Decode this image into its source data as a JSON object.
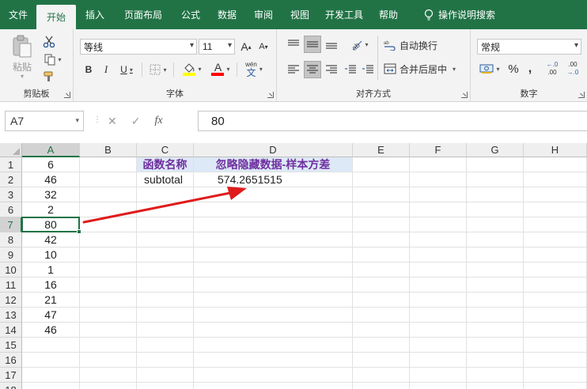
{
  "menu": {
    "tabs": [
      "文件",
      "开始",
      "插入",
      "页面布局",
      "公式",
      "数据",
      "审阅",
      "视图",
      "开发工具",
      "帮助"
    ],
    "active_index": 1,
    "tell_me": "操作说明搜索"
  },
  "ribbon": {
    "clipboard": {
      "paste_label": "粘贴",
      "group_label": "剪贴板"
    },
    "font": {
      "font_name": "等线",
      "font_size": "11",
      "grow": "A",
      "shrink": "A",
      "bold": "B",
      "italic": "I",
      "underline": "U",
      "font_color_letter": "A",
      "phonetic_small": "wén",
      "phonetic_big": "文",
      "group_label": "字体"
    },
    "alignment": {
      "wrap_text": "自动换行",
      "merge_center": "合并后居中",
      "group_label": "对齐方式"
    },
    "number": {
      "format": "常规",
      "percent": "%",
      "comma": ",",
      "inc_decimal": ".00",
      "dec_decimal": ".0",
      "group_label": "数字"
    },
    "colors": {
      "accent": "#217346",
      "fill_yellow": "#ffff00",
      "font_red": "#ff0000",
      "header_purple": "#7030a0",
      "header_fill": "#dde9f6"
    }
  },
  "formula_bar": {
    "name_box": "A7",
    "cancel": "✕",
    "enter": "✓",
    "fx": "fx",
    "value": "80"
  },
  "sheet": {
    "columns": [
      "A",
      "B",
      "C",
      "D",
      "E",
      "F",
      "G",
      "H"
    ],
    "selected_column": "A",
    "rows": [
      {
        "num": "1",
        "A": "6",
        "C": "函数名称",
        "D": "忽略隐藏数据-样本方差"
      },
      {
        "num": "2",
        "A": "46",
        "C": "subtotal",
        "D": "574.2651515"
      },
      {
        "num": "3",
        "A": "32",
        "C": "",
        "D": ""
      },
      {
        "num": "6",
        "A": "2",
        "C": "",
        "D": ""
      },
      {
        "num": "7",
        "A": "80",
        "C": "",
        "D": ""
      },
      {
        "num": "8",
        "A": "42",
        "C": "",
        "D": ""
      },
      {
        "num": "9",
        "A": "10",
        "C": "",
        "D": ""
      },
      {
        "num": "10",
        "A": "1",
        "C": "",
        "D": ""
      },
      {
        "num": "11",
        "A": "16",
        "C": "",
        "D": ""
      },
      {
        "num": "12",
        "A": "21",
        "C": "",
        "D": ""
      },
      {
        "num": "13",
        "A": "47",
        "C": "",
        "D": ""
      },
      {
        "num": "14",
        "A": "46",
        "C": "",
        "D": ""
      },
      {
        "num": "15",
        "A": "",
        "C": "",
        "D": ""
      },
      {
        "num": "16",
        "A": "",
        "C": "",
        "D": ""
      },
      {
        "num": "17",
        "A": "",
        "C": "",
        "D": ""
      },
      {
        "num": "18",
        "A": "",
        "C": "",
        "D": ""
      }
    ],
    "selected_row_index": 4,
    "arrow_color": "#e01b1b"
  }
}
